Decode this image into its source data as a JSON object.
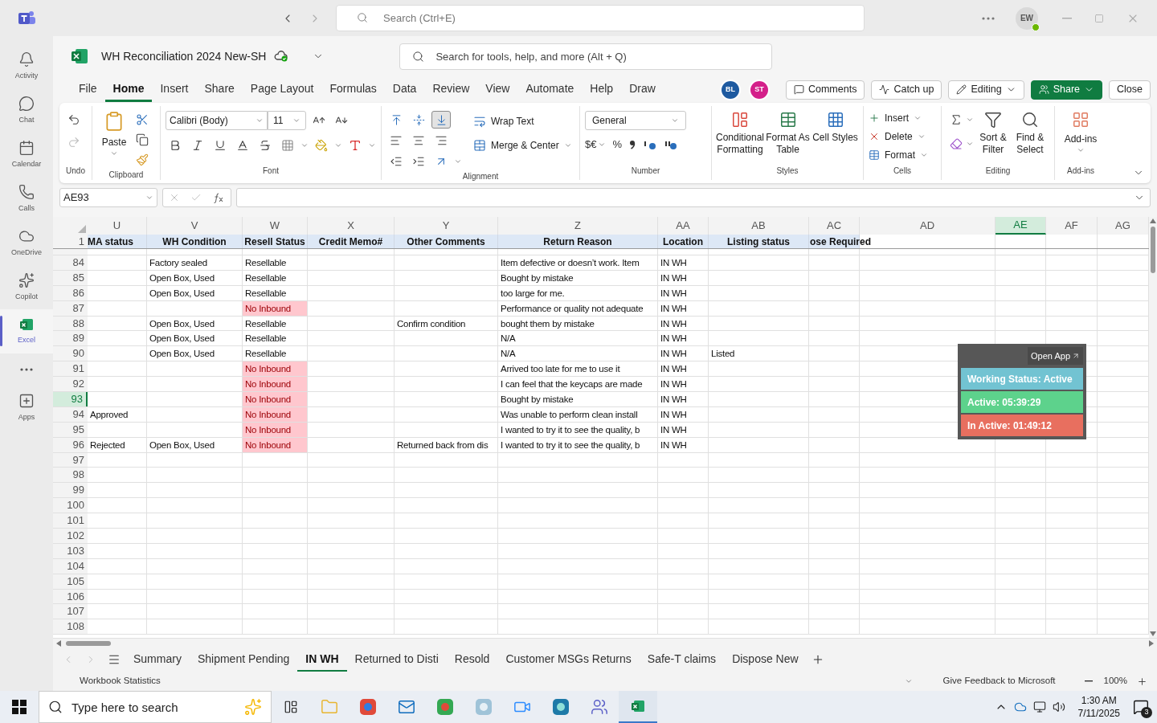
{
  "app_bar": {
    "search_placeholder": "Search (Ctrl+E)",
    "user_initials": "EW"
  },
  "rail": [
    {
      "label": "Activity",
      "selected": false
    },
    {
      "label": "Chat",
      "selected": false
    },
    {
      "label": "Calendar",
      "selected": false
    },
    {
      "label": "Calls",
      "selected": false
    },
    {
      "label": "OneDrive",
      "selected": false
    },
    {
      "label": "Copilot",
      "selected": false
    },
    {
      "label": "Excel",
      "selected": true
    },
    {
      "label": "Apps",
      "selected": false
    }
  ],
  "workbook": {
    "title": "WH Reconciliation 2024 New-SH",
    "tools_search_placeholder": "Search for tools, help, and more (Alt + Q)"
  },
  "menu_tabs": [
    {
      "label": "File",
      "selected": false
    },
    {
      "label": "Home",
      "selected": true
    },
    {
      "label": "Insert",
      "selected": false
    },
    {
      "label": "Share",
      "selected": false
    },
    {
      "label": "Page Layout",
      "selected": false
    },
    {
      "label": "Formulas",
      "selected": false
    },
    {
      "label": "Data",
      "selected": false
    },
    {
      "label": "Review",
      "selected": false
    },
    {
      "label": "View",
      "selected": false
    },
    {
      "label": "Automate",
      "selected": false
    },
    {
      "label": "Help",
      "selected": false
    },
    {
      "label": "Draw",
      "selected": false
    }
  ],
  "collaborators": [
    {
      "initials": "BL",
      "color": "#1e5aa0"
    },
    {
      "initials": "ST",
      "color": "#d4208a"
    }
  ],
  "actions": [
    {
      "label": "Comments",
      "kind": "outline"
    },
    {
      "label": "Catch up",
      "kind": "outline"
    },
    {
      "label": "Editing",
      "kind": "dropdown"
    },
    {
      "label": "Share",
      "kind": "primary"
    },
    {
      "label": "Close",
      "kind": "plain"
    }
  ],
  "ribbon": {
    "undo": {
      "label": "Undo"
    },
    "clipboard": {
      "paste": "Paste",
      "label": "Clipboard"
    },
    "font": {
      "name": "Calibri (Body)",
      "size": "11",
      "label": "Font"
    },
    "alignment": {
      "vertical": [
        {
          "selected": false
        },
        {
          "selected": false
        },
        {
          "selected": true
        }
      ],
      "wrap": "Wrap Text",
      "merge": "Merge & Center",
      "label": "Alignment"
    },
    "number": {
      "format": "General",
      "currency": "$€",
      "percent": "%",
      "label": "Number"
    },
    "styles": {
      "items": [
        "Conditional Formatting",
        "Format As Table",
        "Cell Styles"
      ],
      "label": "Styles"
    },
    "cells": {
      "items": [
        "Insert",
        "Delete",
        "Format"
      ],
      "label": "Cells"
    },
    "editing": {
      "items": [
        "Sort & Filter",
        "Find & Select"
      ],
      "label": "Editing"
    },
    "addins": {
      "button": "Add-ins",
      "label": "Add-ins"
    }
  },
  "formula_bar": {
    "name_box": "AE93"
  },
  "sheet": {
    "columns": [
      {
        "letter": "U",
        "selected": false
      },
      {
        "letter": "V",
        "selected": false
      },
      {
        "letter": "W",
        "selected": false
      },
      {
        "letter": "X",
        "selected": false
      },
      {
        "letter": "Y",
        "selected": false
      },
      {
        "letter": "Z",
        "selected": false
      },
      {
        "letter": "AA",
        "selected": false
      },
      {
        "letter": "AB",
        "selected": false
      },
      {
        "letter": "AC",
        "selected": false
      },
      {
        "letter": "AD",
        "selected": false
      },
      {
        "letter": "AE",
        "selected": true
      },
      {
        "letter": "AF",
        "selected": false
      },
      {
        "letter": "AG",
        "selected": false
      }
    ],
    "header_row": {
      "number": "1",
      "cells": {
        "U": "MA status",
        "V": "WH Condition",
        "W": "Resell Status",
        "X": "Credit Memo#",
        "Y": "Other Comments",
        "Z": "Return Reason",
        "AA": "Location",
        "AB": "Listing status",
        "AC": "ose Required"
      }
    },
    "rows": [
      {
        "number": "84",
        "selected": false,
        "flagged": false,
        "cells": {
          "V": "Factory sealed",
          "W": "Resellable",
          "Z": "Item defective or doesn’t work. Item",
          "AA": "IN WH"
        }
      },
      {
        "number": "85",
        "selected": false,
        "flagged": false,
        "cells": {
          "V": "Open Box, Used",
          "W": "Resellable",
          "Z": "Bought by mistake",
          "AA": "IN WH"
        }
      },
      {
        "number": "86",
        "selected": false,
        "flagged": false,
        "cells": {
          "V": "Open Box, Used",
          "W": "Resellable",
          "Z": "too large for me.",
          "AA": "IN WH"
        }
      },
      {
        "number": "87",
        "selected": false,
        "flagged": true,
        "cells": {
          "W": "No Inbound",
          "Z": "Performance or quality not adequate",
          "AA": "IN WH"
        }
      },
      {
        "number": "88",
        "selected": false,
        "flagged": false,
        "cells": {
          "V": "Open Box, Used",
          "W": "Resellable",
          "Y": "Confirm condition",
          "Z": "bought them by mistake",
          "AA": "IN WH"
        }
      },
      {
        "number": "89",
        "selected": false,
        "flagged": false,
        "cells": {
          "V": "Open Box, Used",
          "W": "Resellable",
          "Z": "N/A",
          "AA": "IN WH"
        }
      },
      {
        "number": "90",
        "selected": false,
        "flagged": false,
        "cells": {
          "V": "Open Box, Used",
          "W": "Resellable",
          "Z": "N/A",
          "AA": "IN WH",
          "AB": "Listed"
        }
      },
      {
        "number": "91",
        "selected": false,
        "flagged": true,
        "cells": {
          "W": "No Inbound",
          "Z": "Arrived too late for me to use it",
          "AA": "IN WH"
        }
      },
      {
        "number": "92",
        "selected": false,
        "flagged": true,
        "cells": {
          "W": "No Inbound",
          "Z": "I can feel that the keycaps are made",
          "AA": "IN WH"
        }
      },
      {
        "number": "93",
        "selected": true,
        "flagged": true,
        "cells": {
          "W": "No Inbound",
          "Z": "Bought by mistake",
          "AA": "IN WH"
        }
      },
      {
        "number": "94",
        "selected": false,
        "flagged": true,
        "cells": {
          "U": "Approved",
          "W": "No Inbound",
          "Z": "Was unable to perform clean install",
          "AA": "IN WH"
        }
      },
      {
        "number": "95",
        "selected": false,
        "flagged": true,
        "cells": {
          "W": "No Inbound",
          "Z": "I wanted to try it to see the quality, b",
          "AA": "IN WH"
        }
      },
      {
        "number": "96",
        "selected": false,
        "flagged": true,
        "cells": {
          "U": "Rejected",
          "V": "Open Box, Used",
          "W": "No Inbound",
          "Y": "Returned back from dis",
          "Z": "I wanted to try it to see the quality, b",
          "AA": "IN WH"
        }
      },
      {
        "number": "97",
        "selected": false,
        "flagged": false,
        "cells": {}
      },
      {
        "number": "98",
        "selected": false,
        "flagged": false,
        "cells": {}
      },
      {
        "number": "99",
        "selected": false,
        "flagged": false,
        "cells": {}
      },
      {
        "number": "100",
        "selected": false,
        "flagged": false,
        "cells": {}
      },
      {
        "number": "101",
        "selected": false,
        "flagged": false,
        "cells": {}
      },
      {
        "number": "102",
        "selected": false,
        "flagged": false,
        "cells": {}
      },
      {
        "number": "103",
        "selected": false,
        "flagged": false,
        "cells": {}
      },
      {
        "number": "104",
        "selected": false,
        "flagged": false,
        "cells": {}
      },
      {
        "number": "105",
        "selected": false,
        "flagged": false,
        "cells": {}
      },
      {
        "number": "106",
        "selected": false,
        "flagged": false,
        "cells": {}
      },
      {
        "number": "107",
        "selected": false,
        "flagged": false,
        "cells": {}
      },
      {
        "number": "108",
        "selected": false,
        "flagged": false,
        "cells": {}
      }
    ]
  },
  "widget": {
    "button": "Open App",
    "items": [
      {
        "text": "Working Status: Active",
        "color": "#72c3d2"
      },
      {
        "text": "Active: 05:39:29",
        "color": "#5dd28c"
      },
      {
        "text": "In Active: 01:49:12",
        "color": "#e86f5f"
      }
    ]
  },
  "sheet_tabs": [
    {
      "label": "Summary",
      "selected": false
    },
    {
      "label": "Shipment Pending",
      "selected": false
    },
    {
      "label": "IN WH",
      "selected": true
    },
    {
      "label": "Returned to Disti",
      "selected": false
    },
    {
      "label": "Resold",
      "selected": false
    },
    {
      "label": "Customer MSGs Returns",
      "selected": false
    },
    {
      "label": "Safe-T claims",
      "selected": false
    },
    {
      "label": "Dispose New",
      "selected": false
    }
  ],
  "status_bar": {
    "statistics": "Workbook Statistics",
    "feedback": "Give Feedback to Microsoft",
    "zoom": "100%"
  },
  "taskbar": {
    "search_placeholder": "Type here to search",
    "time": "1:30 AM",
    "date": "7/11/2025",
    "notifications": "3"
  }
}
